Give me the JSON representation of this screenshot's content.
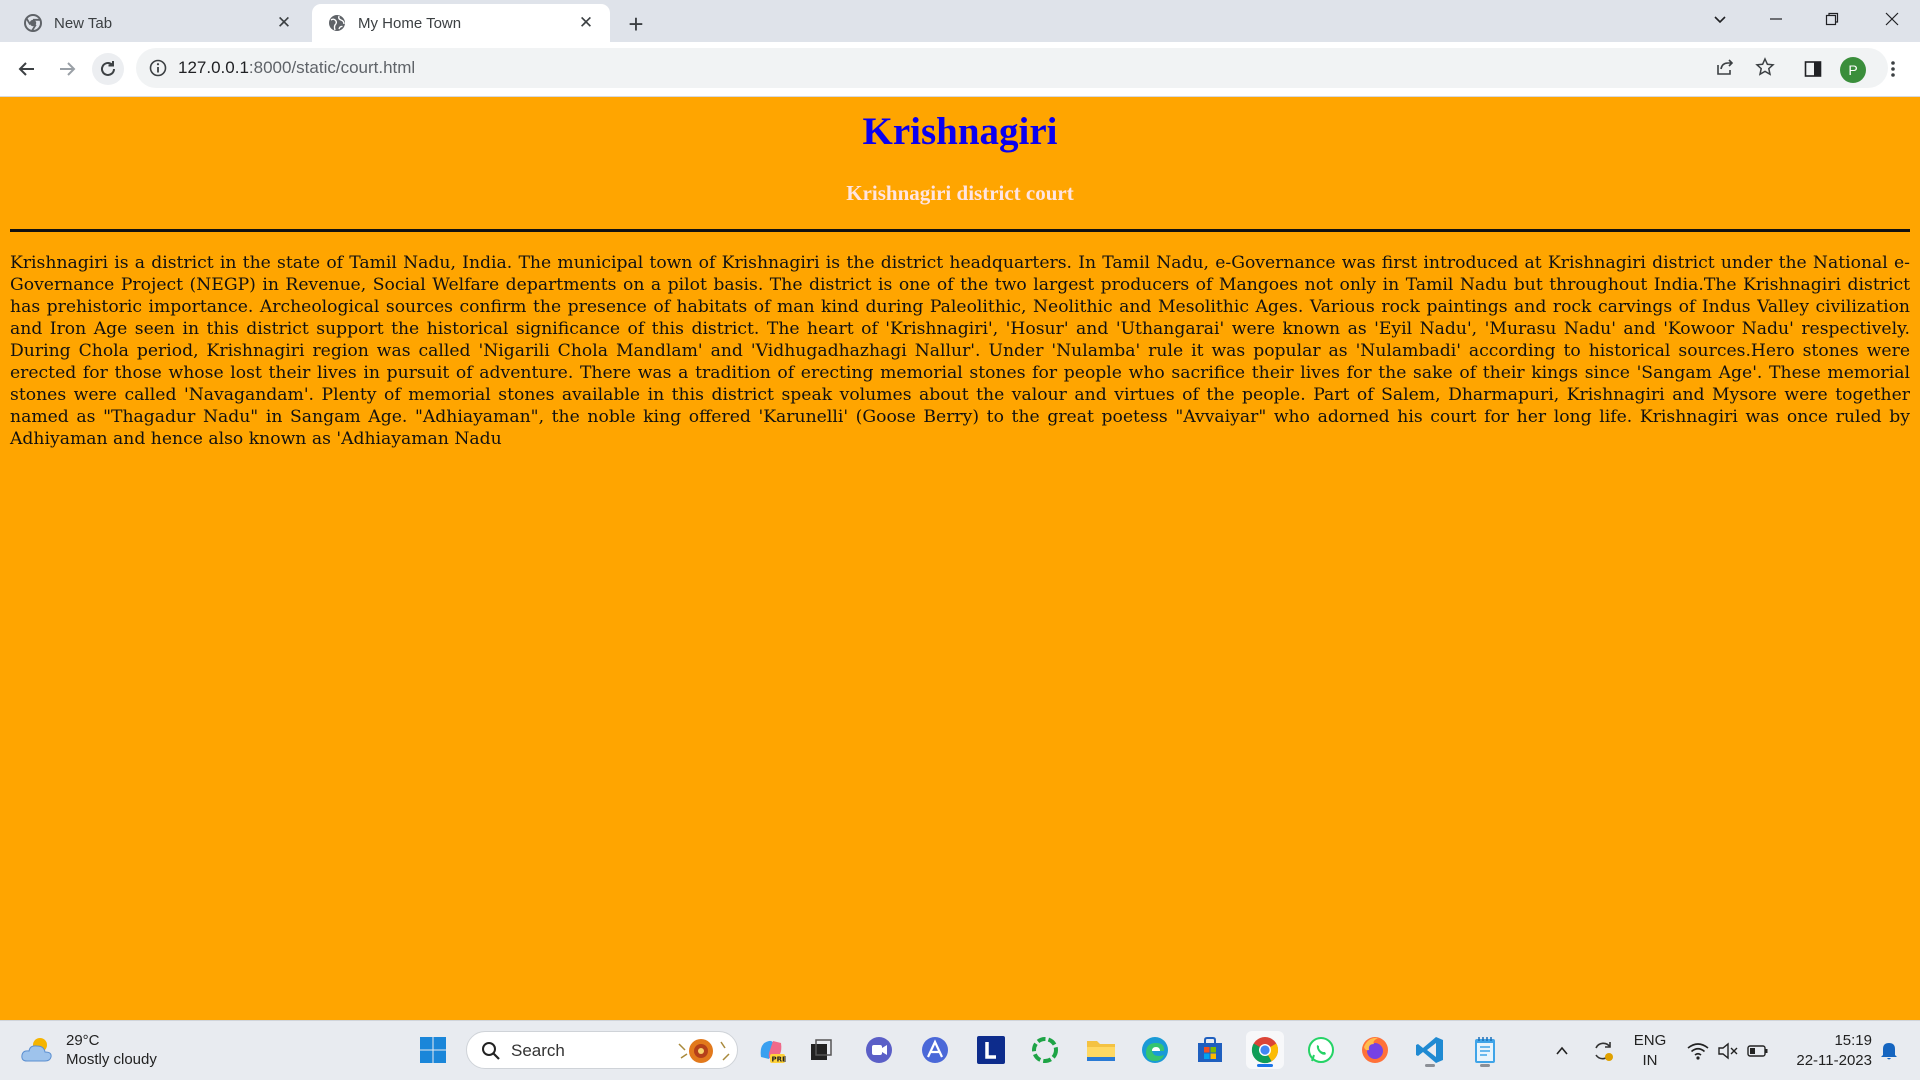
{
  "browser": {
    "tabs": [
      {
        "title": "New Tab",
        "active": false
      },
      {
        "title": "My Home Town",
        "active": true
      }
    ],
    "url_host": "127.0.0.1",
    "url_rest": ":8000/static/court.html",
    "profile_initial": "P"
  },
  "page": {
    "heading": "Krishnagiri",
    "subheading": "Krishnagiri district court",
    "paragraph": "Krishnagiri is a district in the state of Tamil Nadu, India. The municipal town of Krishnagiri is the district headquarters. In Tamil Nadu, e-Governance was first introduced at Krishnagiri district under the National e-Governance Project (NEGP) in Revenue, Social Welfare departments on a pilot basis. The district is one of the two largest producers of Mangoes not only in Tamil Nadu but throughout India.The Krishnagiri district has prehistoric importance. Archeological sources confirm the presence of habitats of man kind during Paleolithic, Neolithic and Mesolithic Ages. Various rock paintings and rock carvings of Indus Valley civilization and Iron Age seen in this district support the historical significance of this district. The heart of 'Krishnagiri', 'Hosur' and 'Uthangarai' were known as 'Eyil Nadu', 'Murasu Nadu' and 'Kowoor Nadu' respectively. During Chola period, Krishnagiri region was called 'Nigarili Chola Mandlam' and 'Vidhugadhazhagi Nallur'. Under 'Nulamba' rule it was popular as 'Nulambadi' according to historical sources.Hero stones were erected for those whose lost their lives in pursuit of adventure. There was a tradition of erecting memorial stones for people who sacrifice their lives for the sake of their kings since 'Sangam Age'. These memorial stones were called 'Navagandam'. Plenty of memorial stones available in this district speak volumes about the valour and virtues of the people. Part of Salem, Dharmapuri, Krishnagiri and Mysore were together named as \"Thagadur Nadu\" in Sangam Age. \"Adhiayaman\", the noble king offered 'Karunelli' (Goose Berry) to the great poetess \"Avvaiyar\" who adorned his court for her long life. Krishnagiri was once ruled by Adhiyaman and hence also known as 'Adhiayaman Nadu",
    "colors": {
      "background": "#ffa500",
      "heading": "#0b00f0",
      "subheading": "#ffe4e1"
    }
  },
  "taskbar": {
    "weather": {
      "temp": "29°C",
      "condition": "Mostly cloudy"
    },
    "search_label": "Search",
    "lang_line1": "ENG",
    "lang_line2": "IN",
    "time": "15:19",
    "date": "22-11-2023"
  }
}
